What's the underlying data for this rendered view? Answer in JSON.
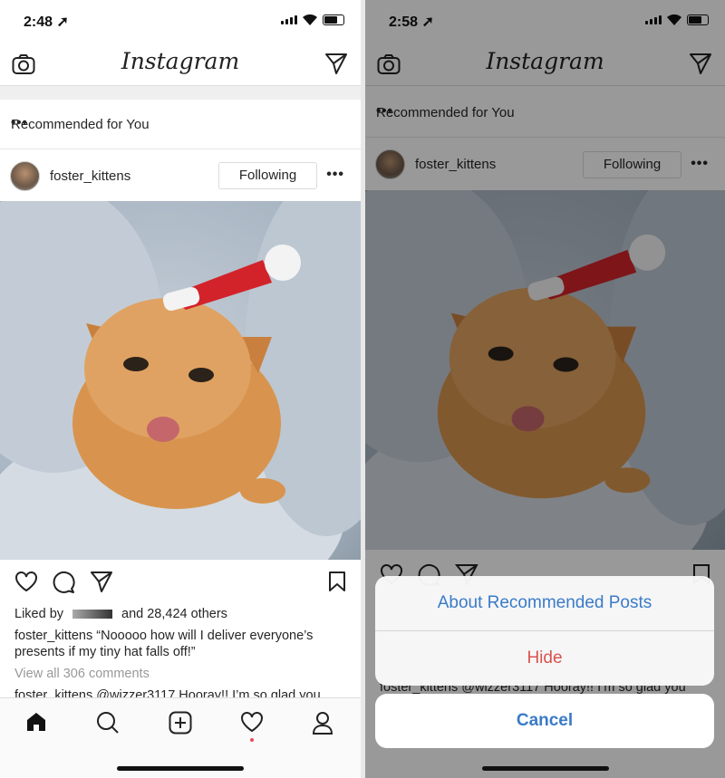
{
  "left": {
    "status": {
      "time": "2:48 ➚"
    },
    "header": {
      "logo": "Instagram"
    },
    "recommended": {
      "title": "Recommended for You",
      "more": "•••"
    },
    "post": {
      "username": "foster_kittens",
      "follow_label": "Following",
      "more": "•••",
      "liked_prefix": "Liked by",
      "liked_suffix": "and 28,424 others",
      "caption_user": "foster_kittens",
      "caption_text": "“Nooooo how will I deliver everyone’s presents if my tiny hat falls off!”",
      "view_comments": "View all 306 comments",
      "comment_user": "foster_kittens",
      "comment_text": "@wizzer3117 Hooray!! I’m so glad you"
    },
    "tabs": [
      "home-icon",
      "search-icon",
      "add-icon",
      "activity-icon",
      "profile-icon"
    ]
  },
  "right": {
    "status": {
      "time": "2:58 ➚"
    },
    "header": {
      "logo": "Instagram"
    },
    "recommended": {
      "title": "Recommended for You",
      "more": "•••"
    },
    "post": {
      "username": "foster_kittens",
      "follow_label": "Following",
      "more": "•••",
      "comment_peek": "foster_kittens @wizzer3117 Hooray!! I’m so glad you"
    },
    "action_sheet": {
      "about_label": "About Recommended Posts",
      "hide_label": "Hide",
      "cancel_label": "Cancel"
    }
  },
  "colors": {
    "ios_blue": "#3a7bc8",
    "destructive_red": "#d9534f",
    "notification_dot": "#ed4956"
  }
}
